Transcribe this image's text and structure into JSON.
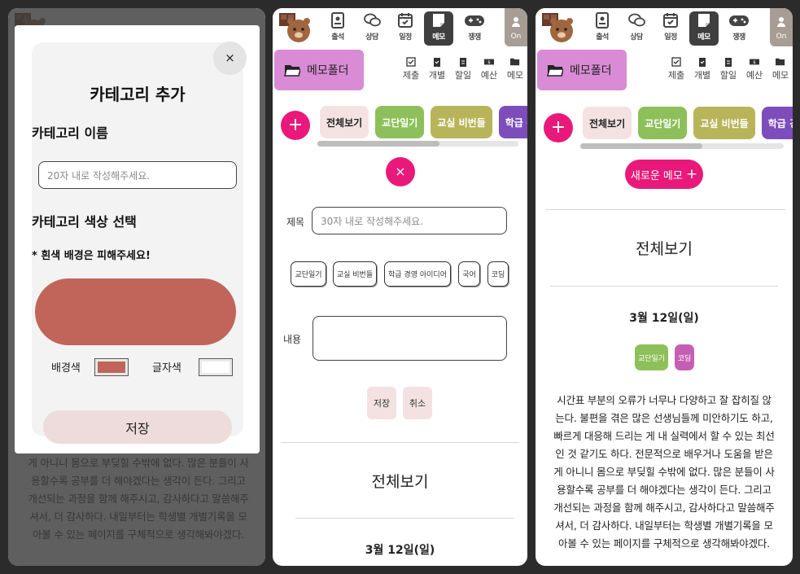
{
  "colors": {
    "accent": "#e8197a",
    "folder": "#d98bd6",
    "selected_bg": "#c1655a",
    "cat_all": "#f4e2e2",
    "cat_diary": "#8dc05a",
    "cat_secret": "#b8b45a",
    "cat_school": "#7d4dbb",
    "tag_coding": "#c55fb5"
  },
  "nav": {
    "items": [
      {
        "label": "출석",
        "icon": "attendance-icon"
      },
      {
        "label": "상담",
        "icon": "chat-icon"
      },
      {
        "label": "일정",
        "icon": "calendar-icon"
      },
      {
        "label": "메모",
        "icon": "memo-icon"
      },
      {
        "label": "쟁쟁",
        "icon": "gamepad-icon"
      }
    ],
    "on_label": "On"
  },
  "folder": {
    "label": "메모폴더"
  },
  "subnav": [
    "제출",
    "개별",
    "할일",
    "예산",
    "메모"
  ],
  "categories": [
    "전체보기",
    "교단일기",
    "교실 비번들",
    "학급 경"
  ],
  "modal": {
    "title": "카테고리 추가",
    "close": "×",
    "name_label": "카테고리 이름",
    "name_placeholder": "20자 내로 작성해주세요.",
    "color_label": "카테고리 색상 선택",
    "warning": "* 흰색 배경은 피해주세요!",
    "bg_label": "배경색",
    "text_label": "글자색",
    "save": "저장"
  },
  "form": {
    "close": "×",
    "title_label": "제목",
    "title_placeholder": "30자 내로 작성해주세요.",
    "tags": [
      "교단일기",
      "교실 비번들",
      "학급 경영 아이디어",
      "국어",
      "코딩"
    ],
    "content_label": "내용",
    "save": "저장",
    "cancel": "취소"
  },
  "new_memo": "새로운 메모",
  "list": {
    "heading": "전체보기",
    "date": "3월 12일(일)",
    "tags": [
      "교단일기",
      "코딩"
    ],
    "memo_full": [
      "시간표 부분의 오류가 너무나 다양하고 잘 잡히질 않",
      "는다. 불편을 겪은 많은 선생님들께 미안하기도 하고,",
      "빠르게 대응해 드리는 게 내 실력에서 할 수 있는 최선",
      "인 것 같기도 하다. 전문적으로 배우거나 도움을 받은",
      "게 아니니 몸으로 부딪힐 수밖에 없다. 많은 분들이 사",
      "용할수록 공부를 더 해야겠다는 생각이 든다. 그리고",
      "개선되는 과정을 함께 해주시고, 감사하다고 말씀해주",
      "셔서, 더 감사하다. 내일부터는 학생별 개별기록을 모",
      "아볼 수 있는 페이지를 구체적으로 생각해봐야겠다."
    ]
  }
}
